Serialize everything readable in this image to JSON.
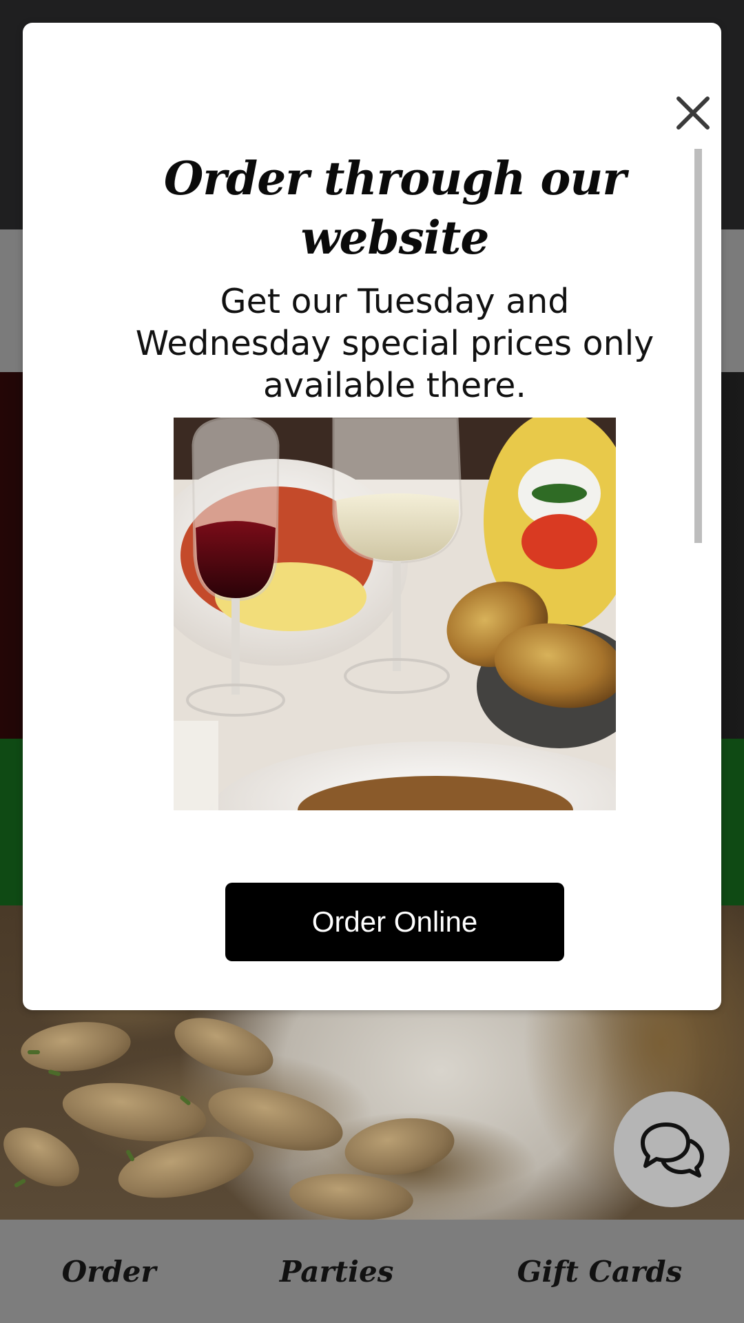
{
  "modal": {
    "title": "Order through our website",
    "subtitle": "Get our Tuesday and Wednesday special prices only available there.",
    "image_icon": "food-and-wine-photo",
    "cta_label": "Order Online",
    "close_icon": "close-icon"
  },
  "bottom_nav": {
    "items": [
      {
        "label": "Order"
      },
      {
        "label": "Parties"
      },
      {
        "label": "Gift Cards"
      }
    ]
  },
  "chat": {
    "icon": "chat-bubbles-icon"
  },
  "colors": {
    "cta_background": "#000000",
    "nav_background": "#7d7d7d",
    "green_band": "#0f4a14",
    "modal_background": "#ffffff"
  }
}
